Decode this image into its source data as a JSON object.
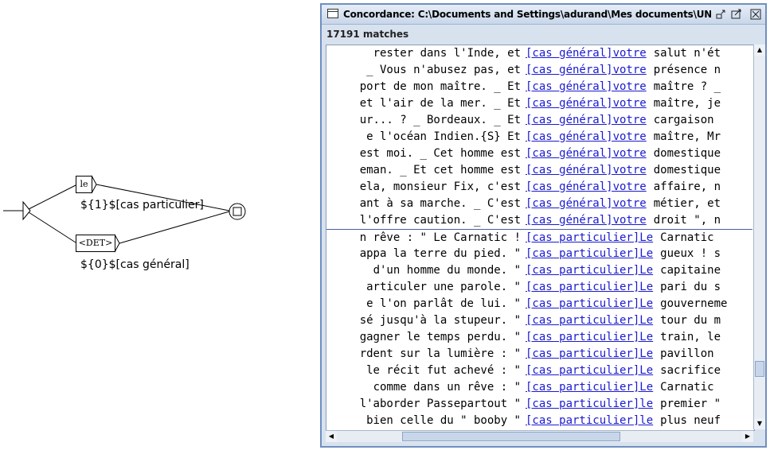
{
  "graph": {
    "box_le": "le",
    "box_det": "<DET>",
    "output_particulier": "${1}$[cas particulier]",
    "output_general": "${0}$[cas général]"
  },
  "window": {
    "title": "Concordance: C:\\Documents and Settings\\adurand\\Mes documents\\UNITEX\\Fren...",
    "matches": "17191 matches",
    "rows": [
      {
        "left": "rester dans l'Inde, et",
        "match": "[cas général]votre",
        "right": "salut n'ét"
      },
      {
        "left": "_ Vous n'abusez pas, et",
        "match": "[cas général]votre",
        "right": "présence n"
      },
      {
        "left": "port de mon maître. _ Et",
        "match": "[cas général]votre",
        "right": "maître ? _"
      },
      {
        "left": "et l'air de la mer. _ Et",
        "match": "[cas général]votre",
        "right": "maître, je"
      },
      {
        "left": "ur... ? _ Bordeaux. _ Et",
        "match": "[cas général]votre",
        "right": "cargaison"
      },
      {
        "left": "e l'océan Indien.{S} Et",
        "match": "[cas général]votre",
        "right": "maître, Mr"
      },
      {
        "left": "est moi. _ Cet homme est",
        "match": "[cas général]votre",
        "right": "domestique"
      },
      {
        "left": "eman. _ Et cet homme est",
        "match": "[cas général]votre",
        "right": "domestique"
      },
      {
        "left": "ela, monsieur Fix, c'est",
        "match": "[cas général]votre",
        "right": "affaire, n"
      },
      {
        "left": "ant à sa marche. _ C'est",
        "match": "[cas général]votre",
        "right": "métier, et"
      },
      {
        "left": "l'offre caution. _ C'est",
        "match": "[cas général]votre",
        "right": "droit \", n"
      },
      {
        "left": "n rêve : \" Le Carnatic !",
        "match": "[cas particulier]Le",
        "right": "Carnatic"
      },
      {
        "left": "appa la terre du pied. \"",
        "match": "[cas particulier]Le",
        "right": "gueux ! s"
      },
      {
        "left": " d'un homme du monde. \"",
        "match": "[cas particulier]Le",
        "right": "capitaine"
      },
      {
        "left": "articuler une parole. \"",
        "match": "[cas particulier]Le",
        "right": "pari du s"
      },
      {
        "left": "e l'on parlât de lui. \"",
        "match": "[cas particulier]Le",
        "right": "gouverneme"
      },
      {
        "left": "sé jusqu'à la stupeur. \"",
        "match": "[cas particulier]Le",
        "right": "tour du m"
      },
      {
        "left": "gagner le temps perdu. \"",
        "match": "[cas particulier]Le",
        "right": "train, le"
      },
      {
        "left": "rdent sur la lumière : \"",
        "match": "[cas particulier]Le",
        "right": "pavillon"
      },
      {
        "left": " le récit fut achevé : \"",
        "match": "[cas particulier]Le",
        "right": "sacrifice"
      },
      {
        "left": " comme dans un rêve : \"",
        "match": "[cas particulier]Le",
        "right": "Carnatic"
      },
      {
        "left": "l'aborder Passepartout \"",
        "match": "[cas particulier]le",
        "right": "premier \""
      },
      {
        "left": "bien celle du \" booby \"",
        "match": "[cas particulier]le",
        "right": "plus neuf"
      }
    ]
  }
}
